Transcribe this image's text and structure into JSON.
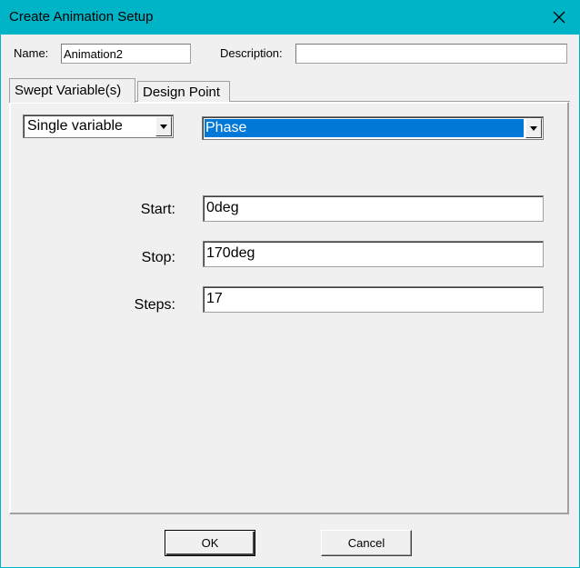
{
  "window": {
    "title": "Create Animation Setup"
  },
  "header": {
    "name_label": "Name:",
    "name_value": "Animation2",
    "description_label": "Description:",
    "description_value": ""
  },
  "tabs": [
    {
      "label": "Swept Variable(s)",
      "active": true
    },
    {
      "label": "Design Point",
      "active": false
    }
  ],
  "swept": {
    "mode_value": "Single variable",
    "variable_value": "Phase",
    "start_label": "Start:",
    "start_value": "0deg",
    "stop_label": "Stop:",
    "stop_value": "170deg",
    "steps_label": "Steps:",
    "steps_value": "17"
  },
  "footer": {
    "ok_label": "OK",
    "cancel_label": "Cancel"
  },
  "icons": {
    "close": "close-icon",
    "dropdown": "triangle-down-icon"
  },
  "colors": {
    "titlebar": "#00b4c8",
    "selection": "#0078d7",
    "face": "#f0f0f0"
  }
}
